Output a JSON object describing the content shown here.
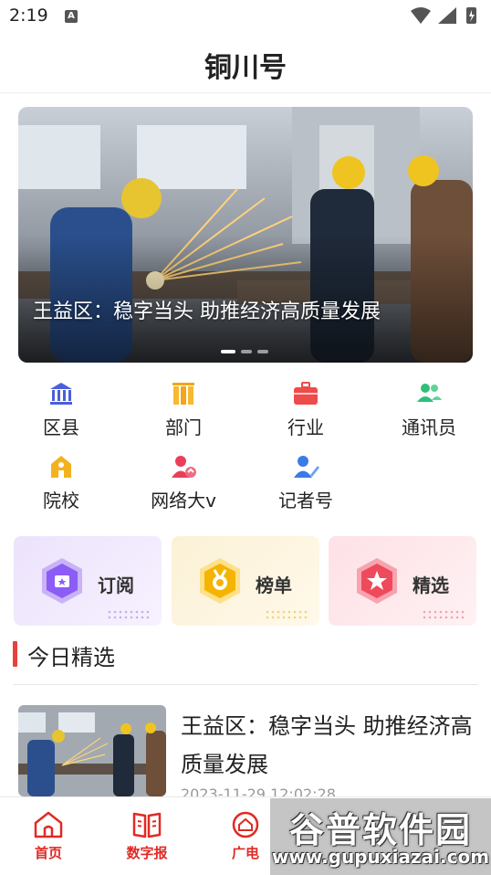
{
  "status_bar": {
    "time": "2:19",
    "notification_glyph": "A"
  },
  "header": {
    "title": "铜川号"
  },
  "banner": {
    "caption": "王益区：稳字当头 助推经济高质量发展",
    "slide_count": 3,
    "active_slide": 1
  },
  "grid": [
    {
      "label": "区县",
      "icon": "government-building-icon",
      "color": "#4a5fd9"
    },
    {
      "label": "部门",
      "icon": "columns-icon",
      "color": "#f3a51d"
    },
    {
      "label": "行业",
      "icon": "briefcase-icon",
      "color": "#ee4b4b"
    },
    {
      "label": "通讯员",
      "icon": "users-icon",
      "color": "#2fbf7a"
    },
    {
      "label": "院校",
      "icon": "school-icon",
      "color": "#f3b21d"
    },
    {
      "label": "网络大v",
      "icon": "influencer-icon",
      "color": "#e8405a"
    },
    {
      "label": "记者号",
      "icon": "reporter-icon",
      "color": "#3a7be8"
    }
  ],
  "features": [
    {
      "label": "订阅",
      "icon": "subscribe-badge-icon",
      "color": "#8b5cf6",
      "bg": "#efe8fb"
    },
    {
      "label": "榜单",
      "icon": "medal-badge-icon",
      "color": "#f5b400",
      "bg": "#fbf3dc"
    },
    {
      "label": "精选",
      "icon": "star-badge-icon",
      "color": "#ef4a5c",
      "bg": "#fde6ea"
    }
  ],
  "section": {
    "title": "今日精选"
  },
  "news": [
    {
      "title": "王益区：稳字当头 助推经济高质量发展",
      "date": "2023-11-29 12:02:28"
    }
  ],
  "tabbar": [
    {
      "label": "首页",
      "icon": "home-icon"
    },
    {
      "label": "数字报",
      "icon": "newspaper-icon"
    },
    {
      "label": "广电",
      "icon": "broadcast-icon"
    }
  ],
  "watermark": {
    "text": "谷普软件园",
    "url": "www.gupuxiazai.com"
  },
  "colors": {
    "accent": "#e02a24",
    "section_bar": "#e8403b"
  }
}
